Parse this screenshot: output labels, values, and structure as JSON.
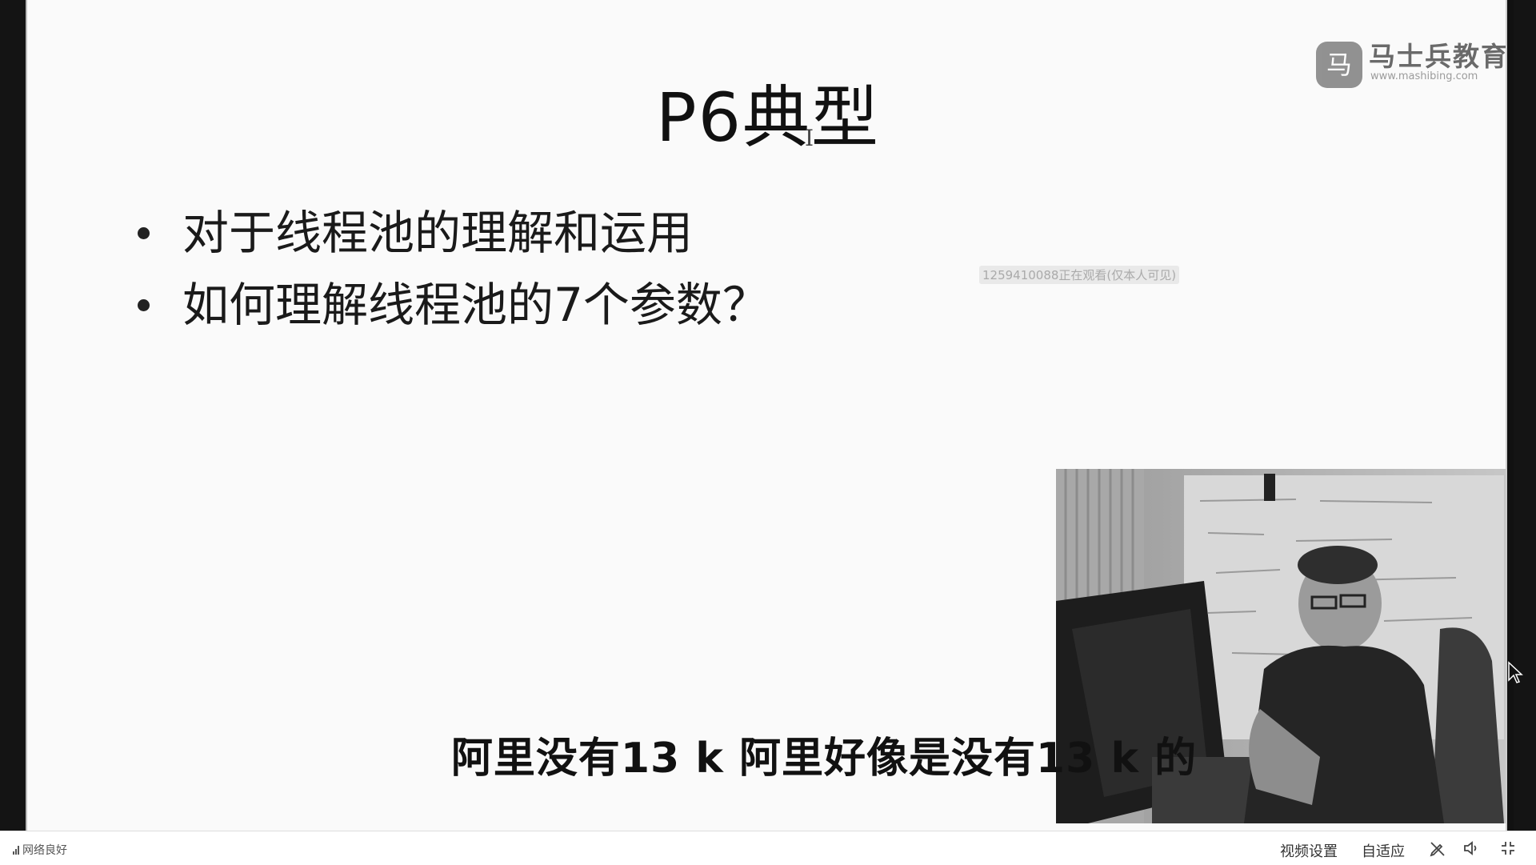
{
  "slide": {
    "title": "P6典型",
    "cursor_glyph": "I",
    "bullets": [
      "对于线程池的理解和运用",
      "如何理解线程池的7个参数？"
    ],
    "watermark": "1259410088正在观看(仅本人可见)"
  },
  "logo": {
    "badge": "马",
    "name": "马士兵教育",
    "url": "www.mashibing.com"
  },
  "webcam": {
    "close_glyph": "×"
  },
  "subtitle": "阿里没有13 k 阿里好像是没有13 k 的",
  "bottom_bar": {
    "network_status": "网络良好",
    "video_settings_label": "视频设置",
    "adaptive_label": "自适应"
  },
  "icons": {
    "pen": "pen-off-icon",
    "volume": "volume-icon",
    "exit_fullscreen": "exit-fullscreen-icon"
  }
}
